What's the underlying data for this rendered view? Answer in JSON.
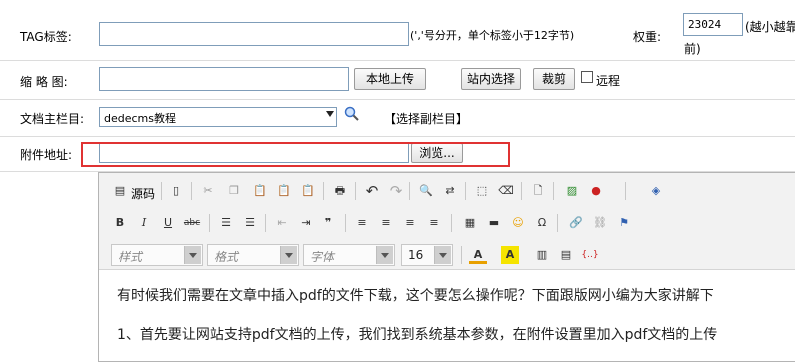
{
  "tag": {
    "label": "TAG标签:",
    "value": "",
    "hint": "(','号分开，单个标签小于12字节)",
    "weight_label": "权重:",
    "weight_value": "23024",
    "weight_hint_1": "(越小越靠",
    "weight_hint_2": "前)"
  },
  "thumbnail": {
    "label": "缩 略 图:",
    "value": "",
    "upload_button": "本地上传",
    "site_select_button": "站内选择",
    "crop_button": "裁剪",
    "remote_label": "远程"
  },
  "category": {
    "label": "文档主栏目:",
    "selected": "dedecms教程",
    "sub_link": "【选择副栏目】"
  },
  "attachment": {
    "label": "附件地址:",
    "value": "",
    "browse_button": "浏览..."
  },
  "editor": {
    "source_label": "源码",
    "style_placeholder": "样式",
    "format_placeholder": "格式",
    "font_placeholder": "字体",
    "size_value": "16",
    "content_line1": "有时候我们需要在文章中插入pdf的文件下载，这个要怎么操作呢？下面跟版网小编为大家讲解下",
    "content_line2": "1、首先要让网站支持pdf文档的上传，我们找到系统基本参数，在附件设置里加入pdf文档的上传"
  },
  "colors": {
    "highlight": "#e03232",
    "border": "#7f9db9"
  }
}
